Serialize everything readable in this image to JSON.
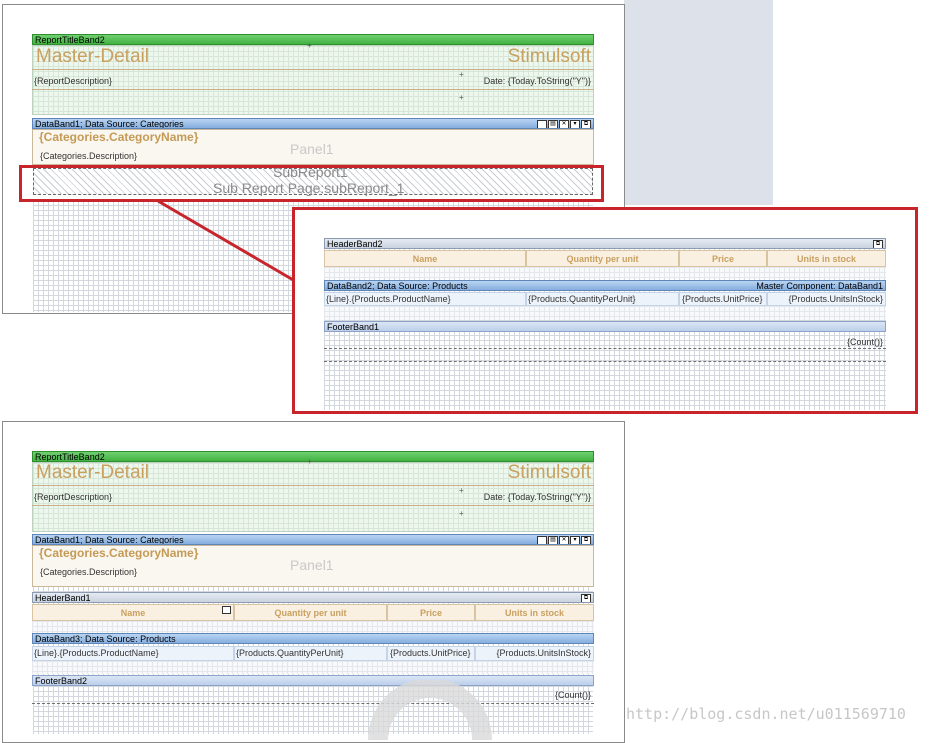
{
  "top_page": {
    "report_title_band": "ReportTitleBand2",
    "title_left": "Master-Detail",
    "title_right": "Stimulsoft",
    "description": "{ReportDescription}",
    "date": "Date: {Today.ToString(\"Y\")}",
    "data_band": "DataBand1; Data Source: Categories",
    "category_name": "{Categories.CategoryName}",
    "category_description": "{Categories.Description}",
    "panel_label": "Panel1",
    "subreport_name": "SubReport1",
    "subreport_page": "Sub Report Page:subReport_1"
  },
  "subreport_page": {
    "header_band": "HeaderBand2",
    "columns": [
      "Name",
      "Quantity per unit",
      "Price",
      "Units in stock"
    ],
    "data_band": "DataBand2; Data Source: Products",
    "master_component": "Master Component: DataBand1",
    "cells": [
      "{Line}.{Products.ProductName}",
      "{Products.QuantityPerUnit}",
      "{Products.UnitPrice}",
      "{Products.UnitsInStock}"
    ],
    "footer_band": "FooterBand1",
    "count": "{Count()}"
  },
  "bottom_page": {
    "report_title_band": "ReportTitleBand2",
    "title_left": "Master-Detail",
    "title_right": "Stimulsoft",
    "description": "{ReportDescription}",
    "date": "Date: {Today.ToString(\"Y\")}",
    "data_band": "DataBand1; Data Source: Categories",
    "category_name": "{Categories.CategoryName}",
    "category_description": "{Categories.Description}",
    "panel_label": "Panel1",
    "header_band": "HeaderBand1",
    "columns": [
      "Name",
      "Quantity per unit",
      "Price",
      "Units in stock"
    ],
    "data_band3": "DataBand3; Data Source: Products",
    "cells": [
      "{Line}.{Products.ProductName}",
      "{Products.QuantityPerUnit}",
      "{Products.UnitPrice}",
      "{Products.UnitsInStock}"
    ],
    "footer_band": "FooterBand2",
    "count": "{Count()}"
  },
  "watermark": "http://blog.csdn.net/u011569710",
  "colors": {
    "highlight": "#c8242c",
    "title": "#c9a060",
    "green_band": "#43b243",
    "blue_band": "#86aedf"
  }
}
